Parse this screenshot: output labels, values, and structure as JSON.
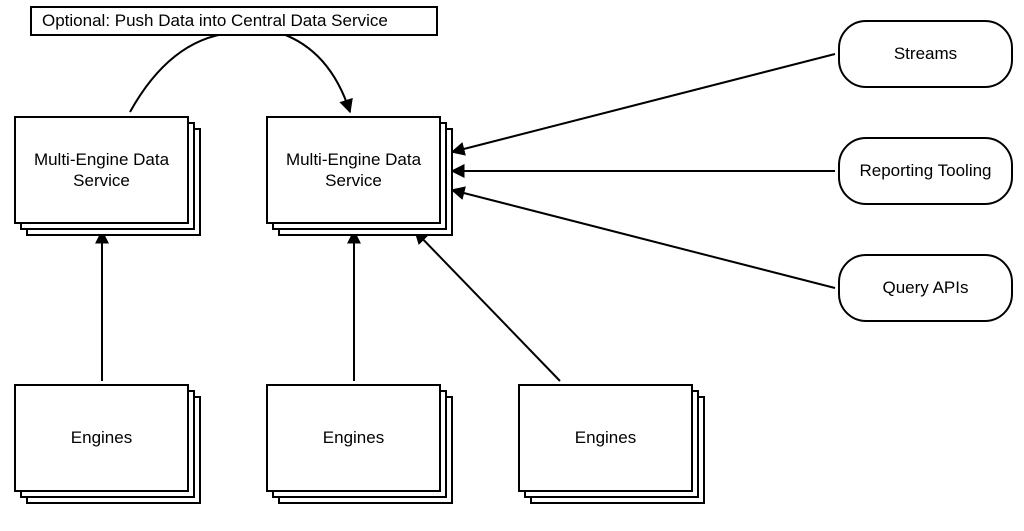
{
  "diagram": {
    "caption": "Optional: Push Data into Central Data Service",
    "nodes": {
      "meds_left": "Multi-Engine Data Service",
      "meds_right": "Multi-Engine Data Service",
      "engines_1": "Engines",
      "engines_2": "Engines",
      "engines_3": "Engines",
      "streams": "Streams",
      "reporting": "Reporting Tooling",
      "query_apis": "Query APIs"
    }
  },
  "chart_data": {
    "type": "diagram",
    "title": "Optional: Push Data into Central Data Service",
    "nodes": [
      {
        "id": "caption",
        "label": "Optional: Push Data into Central Data Service",
        "type": "annotation"
      },
      {
        "id": "meds_left",
        "label": "Multi-Engine Data Service",
        "type": "service-stack"
      },
      {
        "id": "meds_right",
        "label": "Multi-Engine Data Service",
        "type": "service-stack"
      },
      {
        "id": "engines_1",
        "label": "Engines",
        "type": "component-stack"
      },
      {
        "id": "engines_2",
        "label": "Engines",
        "type": "component-stack"
      },
      {
        "id": "engines_3",
        "label": "Engines",
        "type": "component-stack"
      },
      {
        "id": "streams",
        "label": "Streams",
        "type": "external"
      },
      {
        "id": "reporting",
        "label": "Reporting Tooling",
        "type": "external"
      },
      {
        "id": "query_apis",
        "label": "Query APIs",
        "type": "external"
      }
    ],
    "edges": [
      {
        "from": "engines_1",
        "to": "meds_left"
      },
      {
        "from": "engines_2",
        "to": "meds_right"
      },
      {
        "from": "engines_3",
        "to": "meds_right"
      },
      {
        "from": "meds_left",
        "to": "meds_right",
        "via": "caption",
        "style": "curved",
        "label": "Optional: Push Data into Central Data Service"
      },
      {
        "from": "streams",
        "to": "meds_right"
      },
      {
        "from": "reporting",
        "to": "meds_right"
      },
      {
        "from": "query_apis",
        "to": "meds_right"
      }
    ]
  }
}
